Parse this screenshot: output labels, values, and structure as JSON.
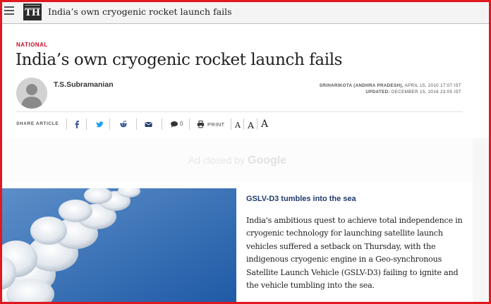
{
  "topbar": {
    "logo_text": "TH",
    "title": "India’s own cryogenic rocket launch fails"
  },
  "article": {
    "section": "NATIONAL",
    "headline": "India’s own cryogenic rocket launch fails",
    "author": "T.S.Subramanian",
    "dateline_place": "SRIHARIKOTA (ANDHRA PRADESH),",
    "dateline_date": "APRIL 15, 2010 17:07 IST",
    "updated_label": "UPDATED:",
    "updated_date": "DECEMBER 15, 2016 23:05 IST"
  },
  "share": {
    "label": "SHARE ARTICLE",
    "icons": [
      "facebook-icon",
      "twitter-icon",
      "reddit-icon",
      "email-icon",
      "comment-icon",
      "print-icon"
    ],
    "comment_count": "0",
    "print_label": "PRINT",
    "font_small": "A",
    "font_medium": "A",
    "font_large": "A"
  },
  "ad": {
    "text_prefix": "Ad closed by",
    "text_brand": "Google"
  },
  "story": {
    "subhead": "GSLV-D3 tumbles into the sea",
    "body": "India's ambitious quest to achieve total independence in cryogenic technology for launching satellite launch vehicles suffered a setback on Thursday, with the indigenous cryogenic engine in a Geo-synchronous Satellite Launch Vehicle (GSLV-D3) failing to ignite and the vehicle tumbling into the sea."
  },
  "colors": {
    "accent": "#c8102e",
    "frame": "#e0181f",
    "facebook": "#3b5998",
    "twitter": "#1da1f2",
    "link": "#1f3b6e"
  }
}
